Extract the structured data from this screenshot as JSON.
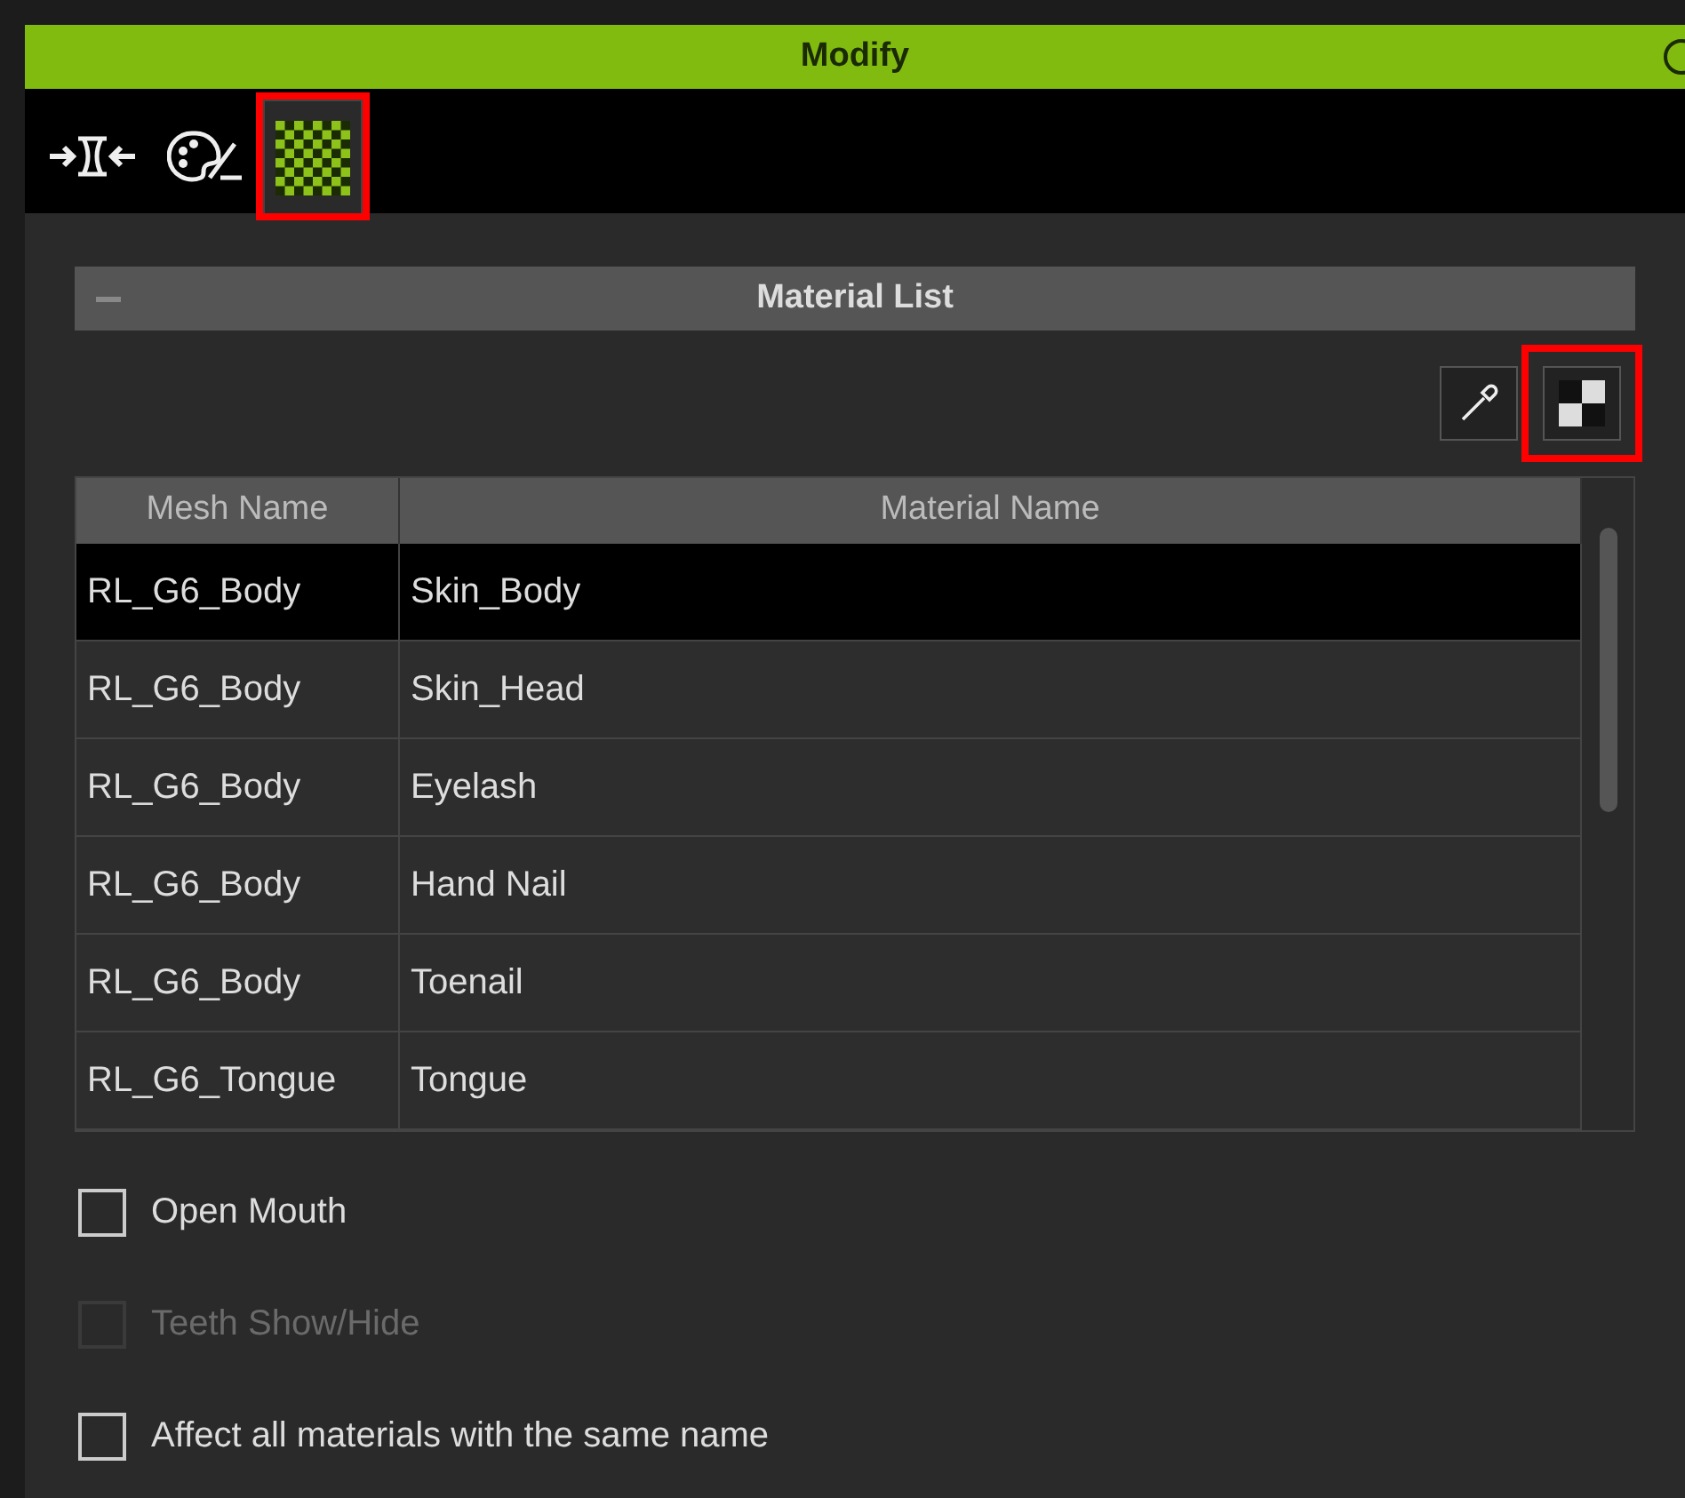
{
  "window": {
    "title": "Modify"
  },
  "tabs": [
    {
      "kind": "morph",
      "selected": false,
      "highlighted": false
    },
    {
      "kind": "palette",
      "selected": false,
      "highlighted": false
    },
    {
      "kind": "checker",
      "selected": true,
      "highlighted": true
    }
  ],
  "section": {
    "title": "Material List",
    "expanded": true
  },
  "toolbar": [
    {
      "kind": "picker",
      "highlighted": false
    },
    {
      "kind": "checker",
      "highlighted": true
    }
  ],
  "table": {
    "columns": [
      "Mesh Name",
      "Material Name"
    ],
    "rows": [
      {
        "cells": [
          "RL_G6_Body",
          "Skin_Body"
        ],
        "selected": true
      },
      {
        "cells": [
          "RL_G6_Body",
          "Skin_Head"
        ],
        "selected": false
      },
      {
        "cells": [
          "RL_G6_Body",
          "Eyelash"
        ],
        "selected": false
      },
      {
        "cells": [
          "RL_G6_Body",
          "Hand Nail"
        ],
        "selected": false
      },
      {
        "cells": [
          "RL_G6_Body",
          "Toenail"
        ],
        "selected": false
      },
      {
        "cells": [
          "RL_G6_Tongue",
          "Tongue"
        ],
        "selected": false
      }
    ]
  },
  "options": [
    {
      "label": "Open Mouth",
      "checked": false,
      "disabled": false
    },
    {
      "label": "Teeth Show/Hide",
      "checked": false,
      "disabled": true
    },
    {
      "label": "Affect all materials with the same name",
      "checked": false,
      "disabled": false
    }
  ]
}
